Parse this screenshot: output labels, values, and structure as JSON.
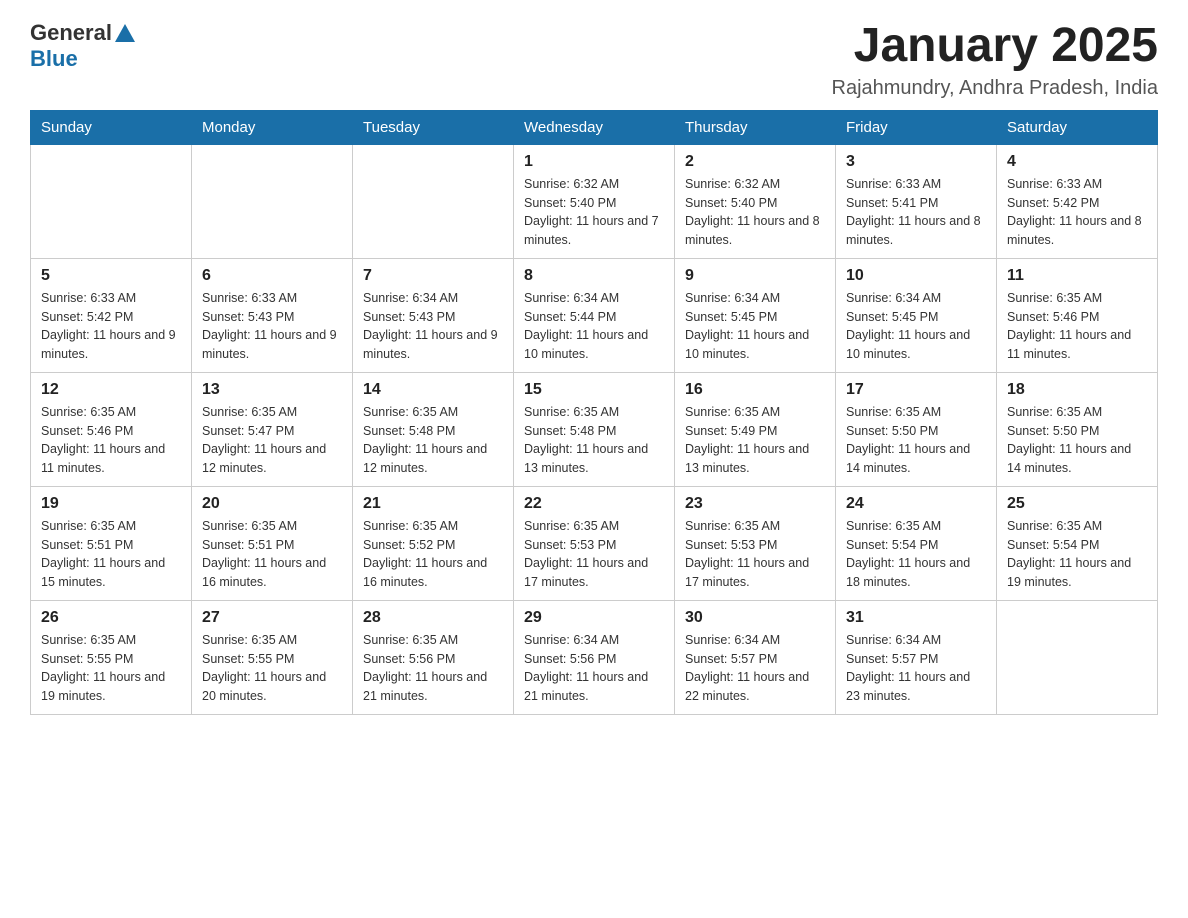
{
  "header": {
    "logo_general": "General",
    "logo_blue": "Blue",
    "title": "January 2025",
    "subtitle": "Rajahmundry, Andhra Pradesh, India"
  },
  "days_of_week": [
    "Sunday",
    "Monday",
    "Tuesday",
    "Wednesday",
    "Thursday",
    "Friday",
    "Saturday"
  ],
  "weeks": [
    [
      {
        "day": "",
        "info": ""
      },
      {
        "day": "",
        "info": ""
      },
      {
        "day": "",
        "info": ""
      },
      {
        "day": "1",
        "info": "Sunrise: 6:32 AM\nSunset: 5:40 PM\nDaylight: 11 hours and 7 minutes."
      },
      {
        "day": "2",
        "info": "Sunrise: 6:32 AM\nSunset: 5:40 PM\nDaylight: 11 hours and 8 minutes."
      },
      {
        "day": "3",
        "info": "Sunrise: 6:33 AM\nSunset: 5:41 PM\nDaylight: 11 hours and 8 minutes."
      },
      {
        "day": "4",
        "info": "Sunrise: 6:33 AM\nSunset: 5:42 PM\nDaylight: 11 hours and 8 minutes."
      }
    ],
    [
      {
        "day": "5",
        "info": "Sunrise: 6:33 AM\nSunset: 5:42 PM\nDaylight: 11 hours and 9 minutes."
      },
      {
        "day": "6",
        "info": "Sunrise: 6:33 AM\nSunset: 5:43 PM\nDaylight: 11 hours and 9 minutes."
      },
      {
        "day": "7",
        "info": "Sunrise: 6:34 AM\nSunset: 5:43 PM\nDaylight: 11 hours and 9 minutes."
      },
      {
        "day": "8",
        "info": "Sunrise: 6:34 AM\nSunset: 5:44 PM\nDaylight: 11 hours and 10 minutes."
      },
      {
        "day": "9",
        "info": "Sunrise: 6:34 AM\nSunset: 5:45 PM\nDaylight: 11 hours and 10 minutes."
      },
      {
        "day": "10",
        "info": "Sunrise: 6:34 AM\nSunset: 5:45 PM\nDaylight: 11 hours and 10 minutes."
      },
      {
        "day": "11",
        "info": "Sunrise: 6:35 AM\nSunset: 5:46 PM\nDaylight: 11 hours and 11 minutes."
      }
    ],
    [
      {
        "day": "12",
        "info": "Sunrise: 6:35 AM\nSunset: 5:46 PM\nDaylight: 11 hours and 11 minutes."
      },
      {
        "day": "13",
        "info": "Sunrise: 6:35 AM\nSunset: 5:47 PM\nDaylight: 11 hours and 12 minutes."
      },
      {
        "day": "14",
        "info": "Sunrise: 6:35 AM\nSunset: 5:48 PM\nDaylight: 11 hours and 12 minutes."
      },
      {
        "day": "15",
        "info": "Sunrise: 6:35 AM\nSunset: 5:48 PM\nDaylight: 11 hours and 13 minutes."
      },
      {
        "day": "16",
        "info": "Sunrise: 6:35 AM\nSunset: 5:49 PM\nDaylight: 11 hours and 13 minutes."
      },
      {
        "day": "17",
        "info": "Sunrise: 6:35 AM\nSunset: 5:50 PM\nDaylight: 11 hours and 14 minutes."
      },
      {
        "day": "18",
        "info": "Sunrise: 6:35 AM\nSunset: 5:50 PM\nDaylight: 11 hours and 14 minutes."
      }
    ],
    [
      {
        "day": "19",
        "info": "Sunrise: 6:35 AM\nSunset: 5:51 PM\nDaylight: 11 hours and 15 minutes."
      },
      {
        "day": "20",
        "info": "Sunrise: 6:35 AM\nSunset: 5:51 PM\nDaylight: 11 hours and 16 minutes."
      },
      {
        "day": "21",
        "info": "Sunrise: 6:35 AM\nSunset: 5:52 PM\nDaylight: 11 hours and 16 minutes."
      },
      {
        "day": "22",
        "info": "Sunrise: 6:35 AM\nSunset: 5:53 PM\nDaylight: 11 hours and 17 minutes."
      },
      {
        "day": "23",
        "info": "Sunrise: 6:35 AM\nSunset: 5:53 PM\nDaylight: 11 hours and 17 minutes."
      },
      {
        "day": "24",
        "info": "Sunrise: 6:35 AM\nSunset: 5:54 PM\nDaylight: 11 hours and 18 minutes."
      },
      {
        "day": "25",
        "info": "Sunrise: 6:35 AM\nSunset: 5:54 PM\nDaylight: 11 hours and 19 minutes."
      }
    ],
    [
      {
        "day": "26",
        "info": "Sunrise: 6:35 AM\nSunset: 5:55 PM\nDaylight: 11 hours and 19 minutes."
      },
      {
        "day": "27",
        "info": "Sunrise: 6:35 AM\nSunset: 5:55 PM\nDaylight: 11 hours and 20 minutes."
      },
      {
        "day": "28",
        "info": "Sunrise: 6:35 AM\nSunset: 5:56 PM\nDaylight: 11 hours and 21 minutes."
      },
      {
        "day": "29",
        "info": "Sunrise: 6:34 AM\nSunset: 5:56 PM\nDaylight: 11 hours and 21 minutes."
      },
      {
        "day": "30",
        "info": "Sunrise: 6:34 AM\nSunset: 5:57 PM\nDaylight: 11 hours and 22 minutes."
      },
      {
        "day": "31",
        "info": "Sunrise: 6:34 AM\nSunset: 5:57 PM\nDaylight: 11 hours and 23 minutes."
      },
      {
        "day": "",
        "info": ""
      }
    ]
  ]
}
